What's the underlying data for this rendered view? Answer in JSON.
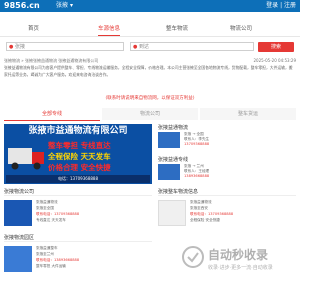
{
  "header": {
    "logo": "9856.cn",
    "city": "张掖",
    "login": "登录 | 注册"
  },
  "nav": [
    "首页",
    "车源信息",
    "整车物流",
    "物流公司"
  ],
  "search": {
    "from": "张掖",
    "to": "到达",
    "button": "搜索"
  },
  "breadcrumb": "张掖物流 » 张掖张掖益通物流 张掖益通物流有限公司",
  "time": "2025-05-20 04:53:29",
  "description": "张掖益通物流有限公司为各客户提供整车、零担、专线物流运输服务，全程安全保障，价格合理。本公司主营张掖至全国各地物流专线，货物配载，整车零担，大件运输，搬家托运等业务，竭诚为广大客户服务。欢迎来电咨询洽谈合作。",
  "notice": "(联系时请说明来自物流网，以保证双方利益)",
  "tabs": [
    "全部专线",
    "物流公司",
    "整车货运"
  ],
  "banner": {
    "title": "张掖市益通物流有限公司",
    "line1": "整车零担 专线直达",
    "line2": "全程保险 天天发车",
    "line3": "价格合理 安全快捷",
    "phone": "电话：13709368888"
  },
  "cards": [
    {
      "title": "张掖益通物流",
      "route": "张掖 → 全国",
      "contact": "联系人：李先生",
      "phone": "13709368888"
    },
    {
      "title": "张掖益通专线",
      "route": "张掖 → 兰州",
      "contact": "联系人：王经理",
      "phone": "13893668888"
    }
  ],
  "sections": [
    {
      "title": "张掖物流公司"
    },
    {
      "title": "张掖整车物流信息"
    },
    {
      "title": "张掖物流园区"
    }
  ],
  "list": [
    {
      "name": "张掖益通物流",
      "route": "张掖至全国",
      "contact": "联系电话：13709368888",
      "note": "专线直达 天天发车"
    },
    {
      "name": "张掖益通整车",
      "route": "张掖至兰州",
      "contact": "联系电话：13893668888",
      "note": "整车零担 大件运输"
    },
    {
      "name": "张掖益通物流",
      "route": "张掖至西安",
      "contact": "联系电话：13709368888",
      "note": "全程保险 安全快捷"
    }
  ],
  "watermark": {
    "title": "自动秒收录",
    "sub": "收录·进步·更多一流·自动收录"
  },
  "colors": {
    "brand": "#0d6fb8",
    "accent": "#e53935"
  }
}
